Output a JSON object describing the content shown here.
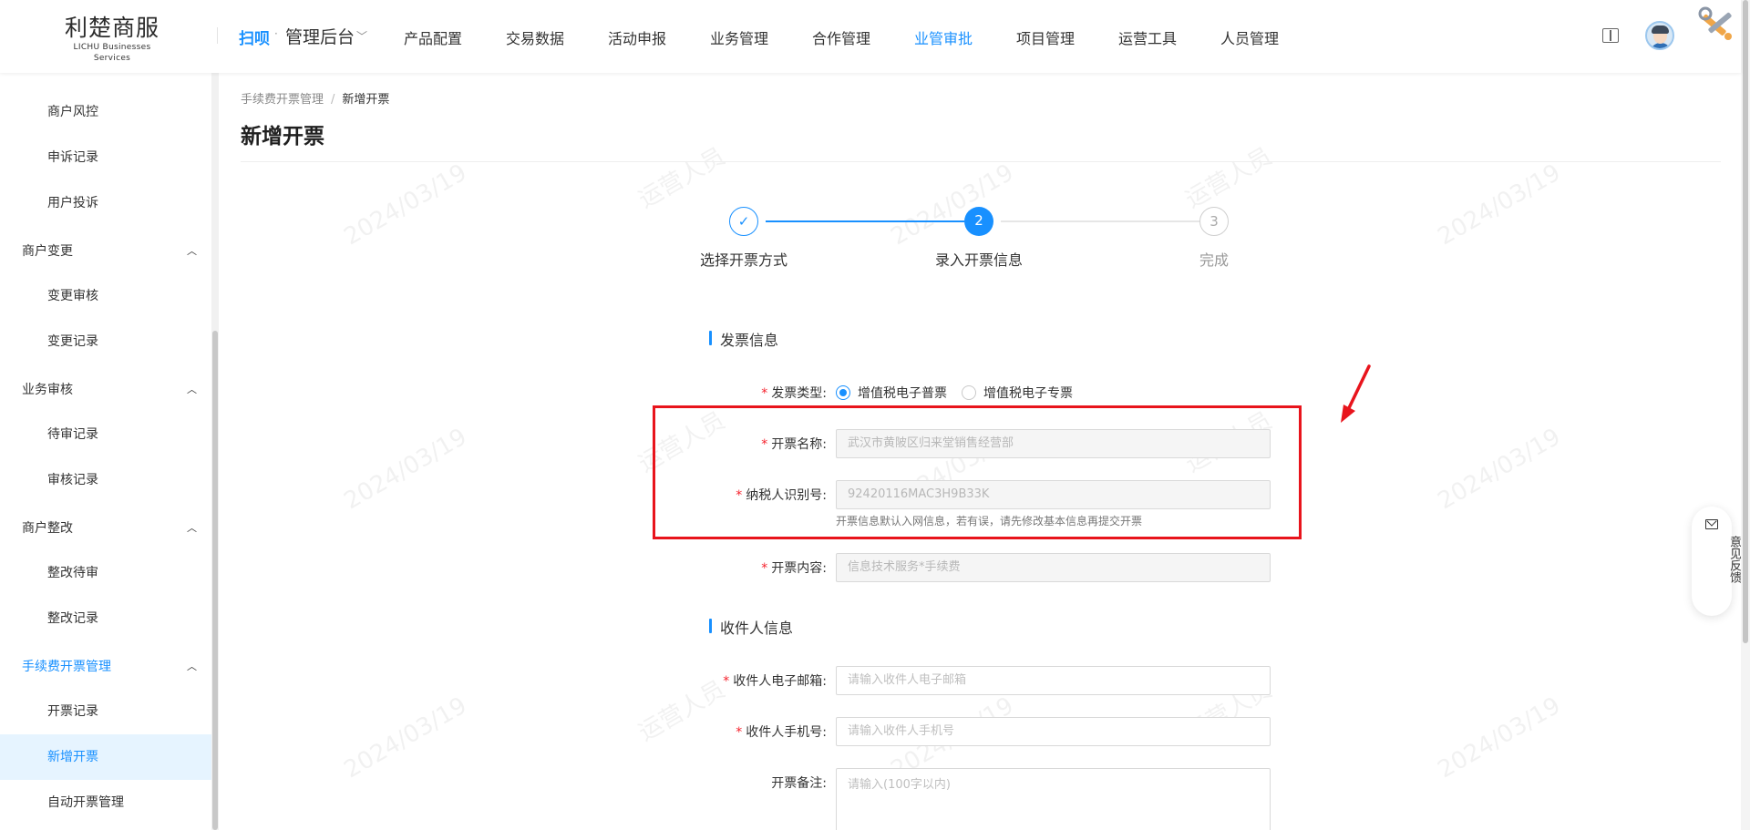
{
  "header": {
    "logo_main": "利楚商服",
    "logo_sub": "LICHU Businesses Services",
    "brand_mark": "扫呗",
    "brand_dot": "·",
    "admin_label": "管理后台",
    "nav": [
      "产品配置",
      "交易数据",
      "活动申报",
      "业务管理",
      "合作管理",
      "业管审批",
      "项目管理",
      "运营工具",
      "人员管理"
    ],
    "active_nav": "业管审批",
    "icons": [
      "book-icon",
      "avatar",
      "tools-icon"
    ]
  },
  "sidebar": {
    "items": [
      {
        "label": "商户风控",
        "kind": "sub"
      },
      {
        "label": "申诉记录",
        "kind": "sub"
      },
      {
        "label": "用户投诉",
        "kind": "sub"
      },
      {
        "label": "商户变更",
        "kind": "group"
      },
      {
        "label": "变更审核",
        "kind": "sub"
      },
      {
        "label": "变更记录",
        "kind": "sub"
      },
      {
        "label": "业务审核",
        "kind": "group"
      },
      {
        "label": "待审记录",
        "kind": "sub"
      },
      {
        "label": "审核记录",
        "kind": "sub"
      },
      {
        "label": "商户整改",
        "kind": "group"
      },
      {
        "label": "整改待审",
        "kind": "sub"
      },
      {
        "label": "整改记录",
        "kind": "sub"
      },
      {
        "label": "手续费开票管理",
        "kind": "group-active"
      },
      {
        "label": "开票记录",
        "kind": "sub"
      },
      {
        "label": "新增开票",
        "kind": "selected"
      },
      {
        "label": "自动开票管理",
        "kind": "sub"
      }
    ]
  },
  "breadcrumb": {
    "parent": "手续费开票管理",
    "separator": "/",
    "current": "新增开票"
  },
  "page_title": "新增开票",
  "steps": [
    {
      "label": "选择开票方式",
      "state": "done",
      "mark": "✓"
    },
    {
      "label": "录入开票信息",
      "state": "active",
      "mark": "2"
    },
    {
      "label": "完成",
      "state": "wait",
      "mark": "3"
    }
  ],
  "invoice_section": {
    "title": "发票信息",
    "type_label": "发票类型:",
    "type_options": [
      "增值税电子普票",
      "增值税电子专票"
    ],
    "type_selected": "增值税电子普票",
    "name_label": "开票名称:",
    "name_value": "武汉市黄陂区归来堂销售经营部",
    "taxid_label": "纳税人识别号:",
    "taxid_value": "92420116MAC3H9B33K",
    "hint": "开票信息默认入网信息，若有误，请先修改基本信息再提交开票",
    "content_label": "开票内容:",
    "content_value": "信息技术服务*手续费"
  },
  "recipient_section": {
    "title": "收件人信息",
    "email_label": "收件人电子邮箱:",
    "email_placeholder": "请输入收件人电子邮箱",
    "phone_label": "收件人手机号:",
    "phone_placeholder": "请输入收件人手机号",
    "remark_label": "开票备注:",
    "remark_placeholder": "请输入(100字以内)"
  },
  "feedback": {
    "label": "意见反馈"
  },
  "watermark": {
    "name": "运营人员",
    "date": "2024/03/19"
  },
  "colors": {
    "primary": "#1890ff",
    "annotation": "#e8141c",
    "required": "#f5222d"
  }
}
